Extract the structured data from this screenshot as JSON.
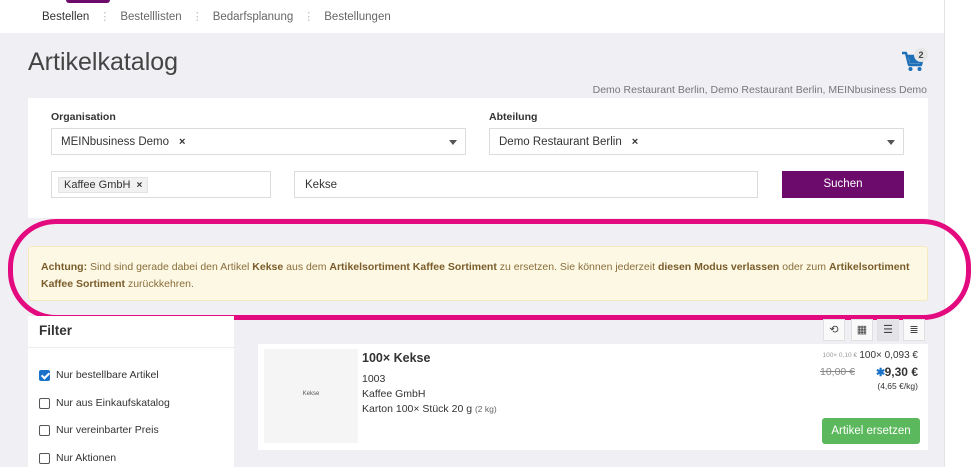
{
  "nav": {
    "tabs": [
      {
        "label": "Bestellen",
        "active": true
      },
      {
        "label": "Bestelllisten",
        "active": false
      },
      {
        "label": "Bedarfsplanung",
        "active": false
      },
      {
        "label": "Bestellungen",
        "active": false
      }
    ],
    "accent_color": "#6d0b6d"
  },
  "header": {
    "title": "Artikelkatalog",
    "cart_count": "2",
    "cart_icon": "shopping-cart-icon",
    "context": "Demo Restaurant Berlin, Demo Restaurant Berlin, MEINbusiness Demo"
  },
  "search": {
    "organisation_label": "Organisation",
    "organisation_value": "MEINbusiness Demo",
    "abteilung_label": "Abteilung",
    "abteilung_value": "Demo Restaurant Berlin",
    "supplier_chip": "Kaffee GmbH",
    "query_value": "Kekse",
    "remove_symbol": "×",
    "button_label": "Suchen"
  },
  "alert": {
    "prefix": "Achtung:",
    "t1": "Sind sind gerade dabei den Artikel",
    "article": "Kekse",
    "t2": "aus dem",
    "sortiment1": "Artikelsortiment Kaffee Sortiment",
    "t3": "zu ersetzen. Sie können jederzeit",
    "mode": "diesen Modus verlassen",
    "t4": "oder zum",
    "sortiment2": "Artikelsortiment Kaffee Sortiment",
    "t5": "zurückkehren.",
    "color_bg": "#fcf8e3",
    "highlight_color": "#e3097e"
  },
  "filter": {
    "title": "Filter",
    "options": [
      {
        "label": "Nur bestellbare Artikel",
        "checked": true
      },
      {
        "label": "Nur aus Einkaufskatalog",
        "checked": false
      },
      {
        "label": "Nur vereinbarter Preis",
        "checked": false
      },
      {
        "label": "Nur Aktionen",
        "checked": false
      }
    ]
  },
  "view_toggles": [
    {
      "icon": "history-icon",
      "glyph": "⟲"
    },
    {
      "icon": "grid-view-icon",
      "glyph": "▦"
    },
    {
      "icon": "list-view-icon",
      "glyph": "☰",
      "active": true
    },
    {
      "icon": "compact-list-icon",
      "glyph": "≣"
    }
  ],
  "product": {
    "image_label": "Kekse",
    "name": "100× Kekse",
    "number": "1003",
    "supplier": "Kaffee GmbH",
    "packaging": "Karton 100× Stück 20 g",
    "weight": "(2 kg)",
    "old_unit_price": "100× 0,10 €",
    "unit_price": "100× 0,093 €",
    "old_price": "10,00 €",
    "price_marker": "✱",
    "price": "9,30 €",
    "price_per_kg": "(4,65 €/kg)",
    "replace_button": "Artikel ersetzen",
    "replace_color": "#5cb85c"
  }
}
